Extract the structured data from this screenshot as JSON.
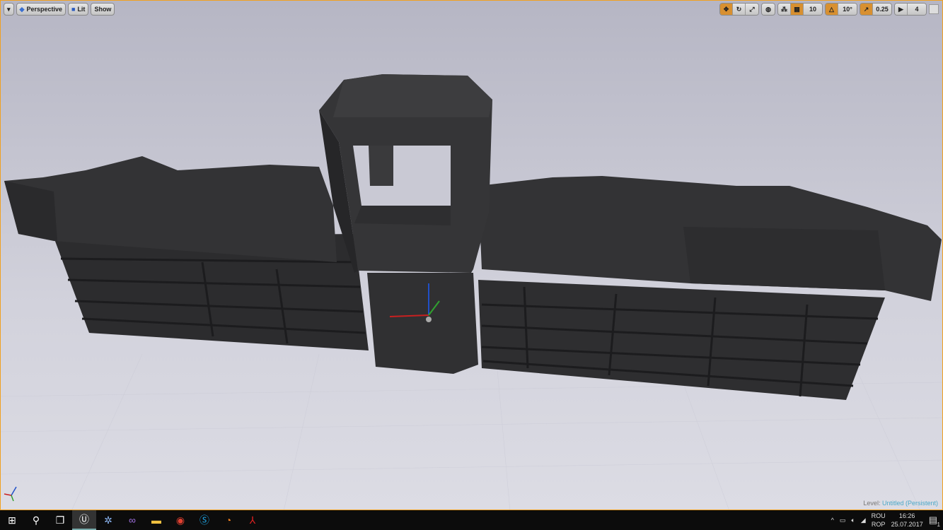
{
  "viewport_toolbar": {
    "menu_icon": "chevron-down-icon",
    "perspective_label": "Perspective",
    "lit_label": "Lit",
    "show_label": "Show",
    "grid_snap_value": "10",
    "rotation_snap_value": "10°",
    "scale_snap_value": "0.25",
    "camera_speed_value": "4"
  },
  "level": {
    "label": "Level:",
    "name": "Untitled (Persistent)"
  },
  "taskbar": {
    "apps": [
      "start",
      "search",
      "task-view",
      "unreal-engine",
      "unity-hub",
      "visual-studio",
      "file-explorer",
      "chrome",
      "skype",
      "blender",
      "acrobat"
    ],
    "lang_top": "ROU",
    "lang_bottom": "ROP",
    "time": "16:26",
    "date": "25.07.2017",
    "notifications": "1"
  },
  "colors": {
    "accent": "#f0a020",
    "level_name": "#4aa8c8"
  }
}
